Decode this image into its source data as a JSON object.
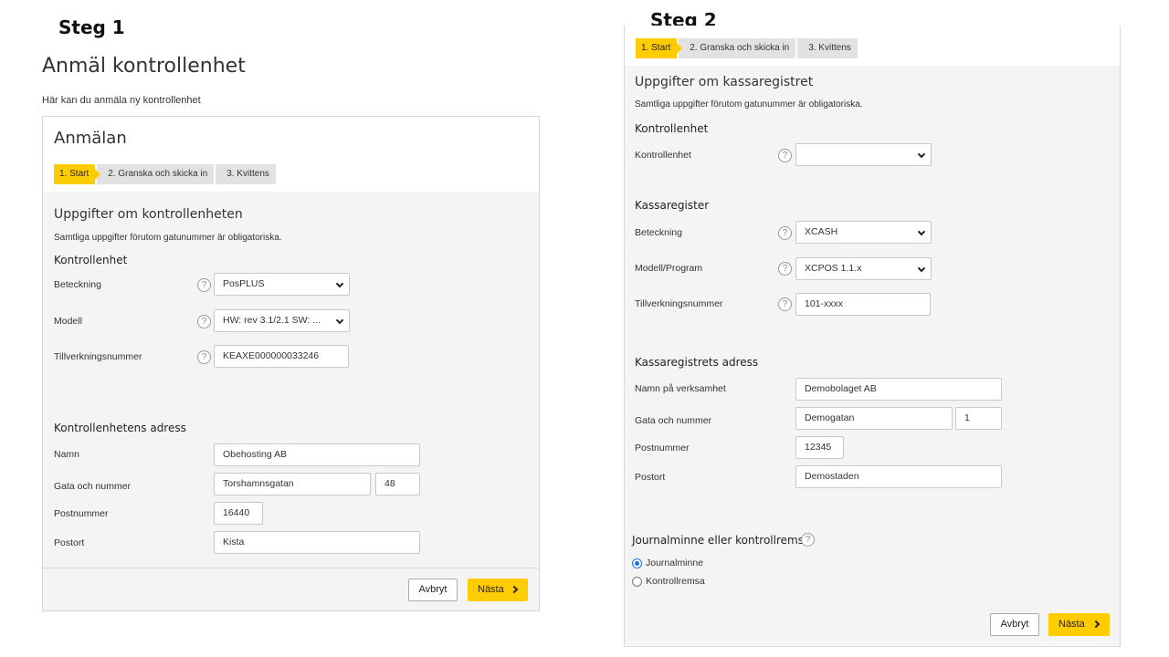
{
  "step1": {
    "heading": "Steg 1",
    "page_title": "Anmäl kontrollenhet",
    "intro": "Här kan du anmäla ny kontrollenhet",
    "card_title": "Anmälan",
    "steps": [
      "1. Start",
      "2. Granska och skicka in",
      "3. Kvittens"
    ],
    "section_title": "Uppgifter om kontrollenheten",
    "note": "Samtliga uppgifter förutom gatunummer är obligatoriska.",
    "unit_group": "Kontrollenhet",
    "unit_fields": {
      "beteckning_label": "Beteckning",
      "beteckning_value": "PosPLUS",
      "modell_label": "Modell",
      "modell_value": "HW: rev 3.1/2.1 SW: ...",
      "tillv_label": "Tillverkningsnummer",
      "tillv_value": "KEAXE000000033246"
    },
    "address_group": "Kontrollenhetens adress",
    "address": {
      "namn_label": "Namn",
      "namn_value": "Obehosting AB",
      "gata_label": "Gata och nummer",
      "gata_value": "Torshamnsgatan",
      "nummer_value": "48",
      "postnr_label": "Postnummer",
      "postnr_value": "16440",
      "postort_label": "Postort",
      "postort_value": "Kista"
    },
    "cancel_label": "Avbryt",
    "next_label": "Nästa"
  },
  "step2": {
    "heading": "Steg 2",
    "steps": [
      "1. Start",
      "2. Granska och skicka in",
      "3. Kvittens"
    ],
    "section_title": "Uppgifter om kassaregistret",
    "note": "Samtliga uppgifter förutom gatunummer är obligatoriska.",
    "unit_group": "Kontrollenhet",
    "unit_label": "Kontrollenhet",
    "unit_value": "",
    "register_group": "Kassaregister",
    "register": {
      "beteckning_label": "Beteckning",
      "beteckning_value": "XCASH",
      "modell_label": "Modell/Program",
      "modell_value": "XCPOS 1.1.x",
      "tillv_label": "Tillverkningsnummer",
      "tillv_value": "101-xxxx"
    },
    "address_group": "Kassaregistrets adress",
    "address": {
      "namn_label": "Namn på verksamhet",
      "namn_value": "Demobolaget AB",
      "gata_label": "Gata och nummer",
      "gata_value": "Demogatan",
      "nummer_value": "1",
      "postnr_label": "Postnummer",
      "postnr_value": "12345",
      "postort_label": "Postort",
      "postort_value": "Demostaden"
    },
    "journal_title": "Journalminne eller kontrollremsa",
    "radio_options": [
      "Journalminne",
      "Kontrollremsa"
    ],
    "radio_selected": "Journalminne",
    "cancel_label": "Avbryt",
    "next_label": "Nästa"
  },
  "icons": {
    "help": "question-circle-icon",
    "chevron": "chevron-down-icon",
    "next_arrow": "chevron-right-icon"
  },
  "colors": {
    "accent": "#ffcc00",
    "panel_bg": "#f4f4f4",
    "radio": "#1a73e8"
  }
}
